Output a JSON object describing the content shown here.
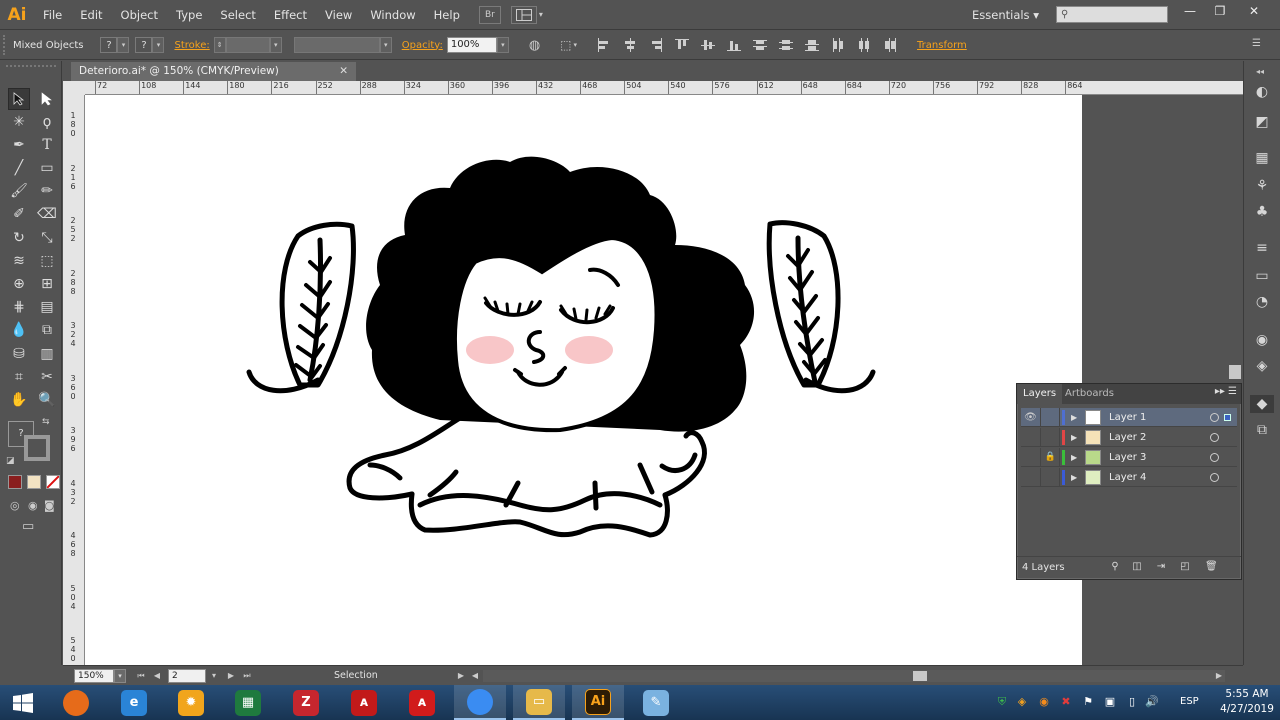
{
  "app": {
    "logo": "Ai"
  },
  "menu": [
    "File",
    "Edit",
    "Object",
    "Type",
    "Select",
    "Effect",
    "View",
    "Window",
    "Help"
  ],
  "menubar_extras": {
    "bridge_btn": "Br"
  },
  "workspace": {
    "label": "Essentials",
    "arrow": "▾"
  },
  "window_controls": {
    "minimize": "—",
    "restore": "❐",
    "close": "✕"
  },
  "control_bar": {
    "selection_type": "Mixed Objects",
    "fill_box": "?",
    "stroke_box": "?",
    "stroke_label": "Stroke:",
    "opacity_label": "Opacity:",
    "opacity_value": "100%",
    "transform_label": "Transform"
  },
  "document": {
    "tab_title": "Deterioro.ai* @ 150% (CMYK/Preview)",
    "close": "✕"
  },
  "ruler": {
    "top_ticks": [
      "72",
      "108",
      "144",
      "180",
      "216",
      "252",
      "288",
      "324",
      "360",
      "396",
      "432",
      "468",
      "504",
      "540",
      "576",
      "612",
      "648",
      "684",
      "720",
      "756",
      "792",
      "828",
      "864"
    ],
    "left_ticks": [
      "180",
      "216",
      "252",
      "288",
      "324",
      "360",
      "396",
      "432",
      "468",
      "504",
      "540"
    ]
  },
  "layers_panel": {
    "tabs": [
      "Layers",
      "Artboards"
    ],
    "layers": [
      {
        "name": "Layer 1",
        "color": "#4f6fd1",
        "thumb": "#ffffff",
        "visible": true,
        "locked": false,
        "selected": true
      },
      {
        "name": "Layer 2",
        "color": "#e04646",
        "thumb": "#f5e2b8",
        "visible": false,
        "locked": false,
        "selected": false
      },
      {
        "name": "Layer 3",
        "color": "#3bbf3b",
        "thumb": "#b9d98a",
        "visible": false,
        "locked": true,
        "selected": false
      },
      {
        "name": "Layer 4",
        "color": "#3b5bd6",
        "thumb": "#dfeec0",
        "visible": false,
        "locked": false,
        "selected": false
      }
    ],
    "layer_count": "4 Layers"
  },
  "status_bar": {
    "zoom": "150%",
    "artboard": "2",
    "status": "Selection"
  },
  "taskbar": {
    "apps": [
      {
        "name": "firefox",
        "glyph": "",
        "color": "#e66b1a"
      },
      {
        "name": "internet-explorer",
        "glyph": "e",
        "color": "#2a84d6"
      },
      {
        "name": "settings-app",
        "glyph": "✹",
        "color": "#f1a51c"
      },
      {
        "name": "excel",
        "glyph": "▦",
        "color": "#1f7a3e"
      },
      {
        "name": "zotero",
        "glyph": "Z",
        "color": "#c6262e"
      },
      {
        "name": "acrobat-reader",
        "glyph": "ᴀ",
        "color": "#c21a1a"
      },
      {
        "name": "acrobat",
        "glyph": "ᴀ",
        "color": "#d11b1b"
      },
      {
        "name": "chrome",
        "glyph": "",
        "color": "#3a8cf2"
      },
      {
        "name": "file-explorer",
        "glyph": "▭",
        "color": "#e6b94a"
      },
      {
        "name": "illustrator",
        "glyph": "Ai",
        "color": "#2d1c05"
      },
      {
        "name": "paint",
        "glyph": "✎",
        "color": "#7ab2e0"
      }
    ],
    "language": "ESP",
    "time": "5:55 AM",
    "date": "4/27/2019"
  },
  "colors": {
    "accent": "#f7a21b",
    "panel": "#535353",
    "artboard": "#ffffff",
    "cheek": "#f8c6c8"
  }
}
